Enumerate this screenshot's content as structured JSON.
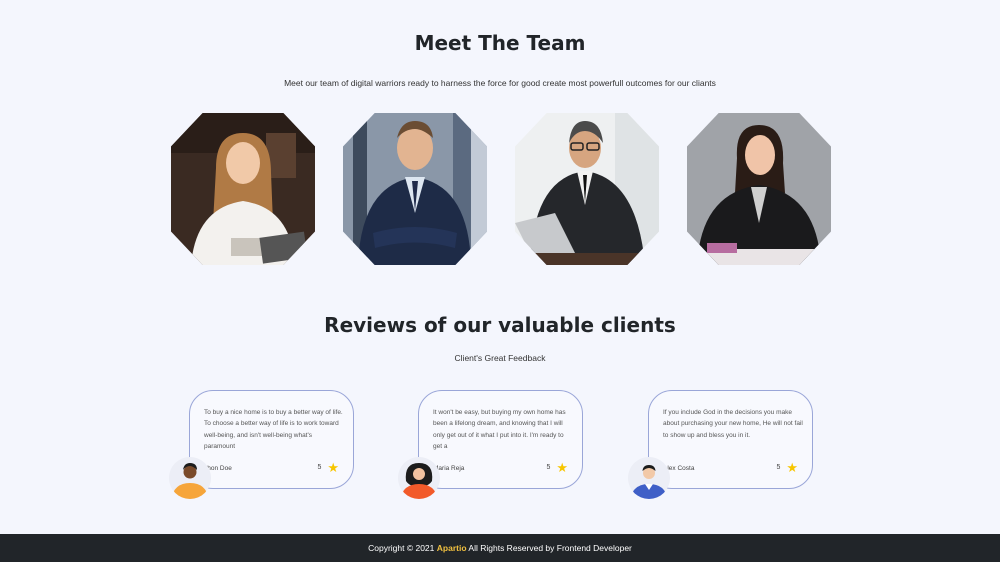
{
  "team": {
    "title": "Meet The Team",
    "subtitle": "Meet our team of digital warriors ready to harness the force for good create most powerfull outcomes for our cliants"
  },
  "reviews": {
    "title": "Reviews of our valuable clients",
    "subtitle": "Client's Great Feedback",
    "items": [
      {
        "text": "To buy a nice home is to buy a better way of life. To choose a better way of life is to work toward well-being, and isn't well-being what's paramount",
        "name": "Jhon Doe",
        "rating": "5"
      },
      {
        "text": "It won't be easy, but buying my own home has been a lifelong dream, and knowing that I will only get out of it what I put into it. I'm ready to get a",
        "name": "Maria Reja",
        "rating": "5"
      },
      {
        "text": "If you include God in the decisions you make about purchasing your new home, He will not fail to show up and bless you in it.",
        "name": "Alex Costa",
        "rating": "5"
      }
    ]
  },
  "footer": {
    "prefix": "Copyright © 2021",
    "brand": "Apartio",
    "suffix": "All Rights Reserved by Frontend Developer"
  },
  "colors": {
    "background": "#f4f6fd",
    "footer": "#212529",
    "brand": "#f0c040",
    "star": "#f7c600",
    "card_border": "#9aa6d8"
  }
}
